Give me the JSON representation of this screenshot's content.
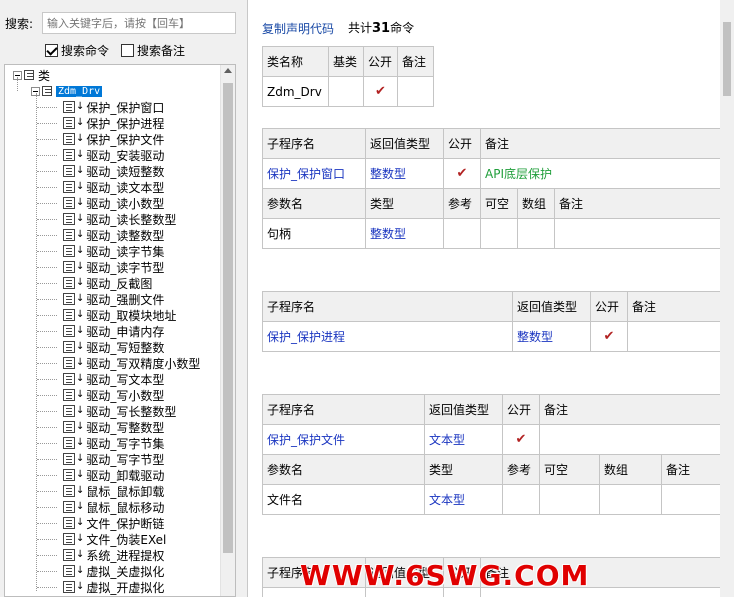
{
  "search": {
    "label": "搜索:",
    "placeholder": "输入关键字后，请按【回车】",
    "options": [
      {
        "label": "搜索命令",
        "checked": true
      },
      {
        "label": "搜索备注",
        "checked": false
      }
    ]
  },
  "tree": {
    "root_label": "类",
    "class_label": "Zdm_Drv",
    "items": [
      "保护_保护窗口",
      "保护_保护进程",
      "保护_保护文件",
      "驱动_安装驱动",
      "驱动_读短整数",
      "驱动_读文本型",
      "驱动_读小数型",
      "驱动_读长整数型",
      "驱动_读整数型",
      "驱动_读字节集",
      "驱动_读字节型",
      "驱动_反截图",
      "驱动_强删文件",
      "驱动_取模块地址",
      "驱动_申请内存",
      "驱动_写短整数",
      "驱动_写双精度小数型",
      "驱动_写文本型",
      "驱动_写小数型",
      "驱动_写长整数型",
      "驱动_写整数型",
      "驱动_写字节集",
      "驱动_写字节型",
      "驱动_卸载驱动",
      "鼠标_鼠标卸载",
      "鼠标_鼠标移动",
      "文件_保护断链",
      "文件_伪装EXel",
      "系统_进程提权",
      "虚拟_关虚拟化",
      "虚拟_开虚拟化"
    ]
  },
  "header": {
    "copy_link": "复制声明代码",
    "total_prefix": "共计",
    "total_count": "31",
    "total_suffix": "命令"
  },
  "class_table": {
    "headers": [
      "类名称",
      "基类",
      "公开",
      "备注"
    ],
    "row": {
      "name": "Zdm_Drv",
      "base": "",
      "public": "✔",
      "note": ""
    }
  },
  "sub_headers": [
    "子程序名",
    "返回值类型",
    "公开",
    "备注"
  ],
  "param_headers": [
    "参数名",
    "类型",
    "参考",
    "可空",
    "数组",
    "备注"
  ],
  "subs": [
    {
      "name": "保护_保护窗口",
      "ret": "整数型",
      "public": "✔",
      "note": "API底层保护",
      "params": [
        {
          "name": "句柄",
          "type": "整数型"
        }
      ]
    },
    {
      "name": "保护_保护进程",
      "ret": "整数型",
      "public": "✔",
      "note": "",
      "params": []
    },
    {
      "name": "保护_保护文件",
      "ret": "文本型",
      "public": "✔",
      "note": "",
      "params": [
        {
          "name": "文件名",
          "type": "文本型"
        }
      ]
    },
    {
      "name": "",
      "ret": "",
      "public": "",
      "note": "",
      "params": []
    }
  ],
  "watermark": "WWW.6SWG.COM"
}
